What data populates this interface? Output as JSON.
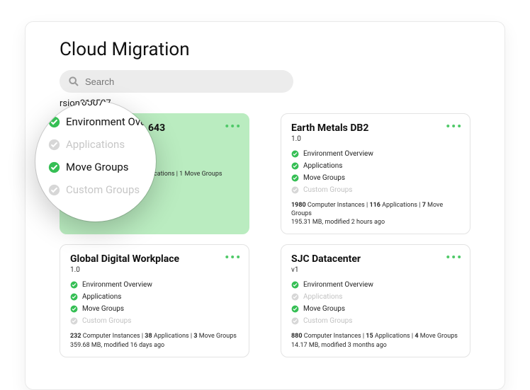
{
  "page_title": "Cloud Migration",
  "search": {
    "placeholder": "Search"
  },
  "version_label": "rsion210507",
  "more_glyph": "•••",
  "cards": [
    {
      "title_frag": "643",
      "subtitle": "",
      "items": [
        {
          "label": "Environment Overview",
          "done": true
        },
        {
          "label": "Applications",
          "done": true
        },
        {
          "label": "Move Groups",
          "done": true
        },
        {
          "label": "Custom Groups",
          "done": false
        }
      ],
      "meta_parts": [
        "",
        "",
        "",
        "1",
        " Move Groups"
      ],
      "meta_line": "cations | 1 Move Groups",
      "size_line": ""
    },
    {
      "title": "Earth Metals DB2",
      "subtitle": "1.0",
      "items": [
        {
          "label": "Environment Overview",
          "done": true
        },
        {
          "label": "Applications",
          "done": true
        },
        {
          "label": "Move Groups",
          "done": true
        },
        {
          "label": "Custom Groups",
          "done": false
        }
      ],
      "meta": {
        "ci": "1980",
        "apps": "116",
        "mg": "7"
      },
      "size_line": "195.31 MB, modified 2 hours ago"
    },
    {
      "title": "Global Digital Workplace",
      "subtitle": "1.0",
      "items": [
        {
          "label": "Environment Overview",
          "done": true
        },
        {
          "label": "Applications",
          "done": true
        },
        {
          "label": "Move Groups",
          "done": true
        },
        {
          "label": "Custom Groups",
          "done": false
        }
      ],
      "meta": {
        "ci": "232",
        "apps": "38",
        "mg": "3"
      },
      "size_line": "359.68 MB, modified 16 days ago"
    },
    {
      "title": "SJC Datacenter",
      "subtitle": "v1",
      "items": [
        {
          "label": "Environment Overview",
          "done": true
        },
        {
          "label": "Applications",
          "done": false
        },
        {
          "label": "Move Groups",
          "done": true
        },
        {
          "label": "Custom Groups",
          "done": false
        }
      ],
      "meta": {
        "ci": "880",
        "apps": "15",
        "mg": "4"
      },
      "size_line": "14.17 MB, modified 3 months ago"
    }
  ],
  "magnifier": {
    "version": "rsion210507",
    "items": [
      {
        "label": "Environment Ove",
        "done": true
      },
      {
        "label": "Applications",
        "done": false
      },
      {
        "label": "Move Groups",
        "done": true
      },
      {
        "label": "Custom Groups",
        "done": false
      }
    ]
  },
  "labels": {
    "ci": " Computer Instances | ",
    "apps": " Applications | ",
    "mg": " Move Groups"
  }
}
